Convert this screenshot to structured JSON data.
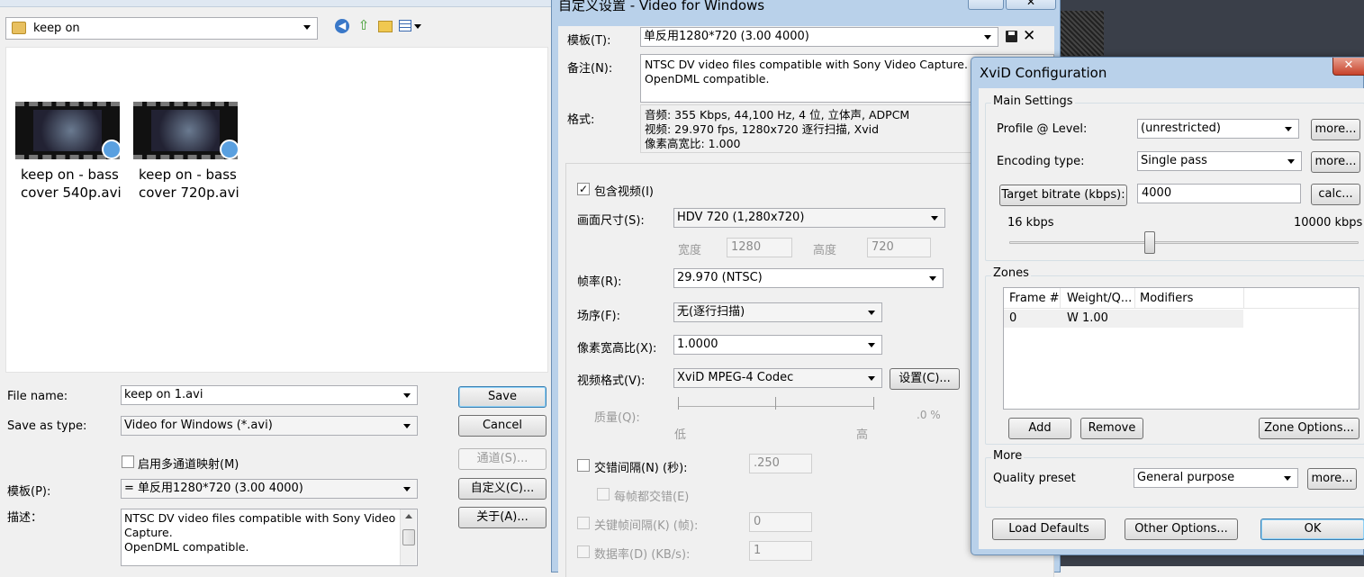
{
  "file_dialog": {
    "location": "keep on",
    "files": [
      {
        "name_line1": "keep on - bass",
        "name_line2": "cover 540p.avi"
      },
      {
        "name_line1": "keep on - bass",
        "name_line2": "cover 720p.avi"
      }
    ],
    "file_name_label": "File name:",
    "file_name_value": "keep on 1.avi",
    "save_as_type_label": "Save as type:",
    "save_as_type_value": "Video for Windows (*.avi)",
    "save_label": "Save",
    "cancel_label": "Cancel",
    "multichannel_label": "启用多通道映射(M)",
    "channels_label": "通道(S)...",
    "template_label": "模板(P):",
    "template_value": "= 单反用1280*720 (3.00 4000)",
    "customize_label": "自定义(C)...",
    "description_label": "描述：",
    "description_text": "NTSC DV video files compatible with Sony Video Capture.\nOpenDML compatible.",
    "about_label": "关于(A)..."
  },
  "custom_settings": {
    "title": "自定义设置 - Video for Windows",
    "template_label": "模板(T):",
    "template_value": "单反用1280*720 (3.00 4000)",
    "notes_label": "备注(N):",
    "notes_text": "NTSC DV video files compatible with Sony Video Capture.\nOpenDML compatible.",
    "format_label": "格式:",
    "format_text": "音频: 355 Kbps, 44,100 Hz, 4 位, 立体声, ADPCM\n视频: 29.970 fps, 1280x720 逐行扫描, Xvid\n像素高宽比: 1.000",
    "include_video_label": "包含视频(I)",
    "frame_size_label": "画面尺寸(S):",
    "frame_size_value": "HDV 720 (1,280x720)",
    "width_label": "宽度",
    "width_value": "1280",
    "height_label": "高度",
    "height_value": "720",
    "frame_rate_label": "帧率(R):",
    "frame_rate_value": "29.970 (NTSC)",
    "field_order_label": "场序(F):",
    "field_order_value": "无(逐行扫描)",
    "pixel_aspect_label": "像素宽高比(X):",
    "pixel_aspect_value": "1.0000",
    "video_format_label": "视频格式(V):",
    "video_format_value": "XviD MPEG-4 Codec",
    "setup_label": "设置(C)...",
    "quality_label": "质量(Q):",
    "quality_low": "低",
    "quality_high": "高",
    "quality_value": ".0 %",
    "interleave_label": "交错间隔(N) (秒):",
    "interleave_value": ".250",
    "interleave_every_frame_label": "每帧都交错(E)",
    "keyframe_label": "关键帧间隔(K) (帧):",
    "keyframe_value": "0",
    "data_rate_label": "数据率(D) (KB/s):",
    "data_rate_value": "1"
  },
  "xvid": {
    "title": "XviD Configuration",
    "main_settings_label": "Main Settings",
    "profile_label": "Profile @ Level:",
    "profile_value": "(unrestricted)",
    "more_label": "more...",
    "encoding_type_label": "Encoding type:",
    "encoding_type_value": "Single pass",
    "target_bitrate_label": "Target bitrate (kbps):",
    "target_bitrate_value": "4000",
    "calc_label": "calc...",
    "bitrate_min": "16 kbps",
    "bitrate_max": "10000 kbps",
    "bitrate_fraction": 0.4,
    "zones_label": "Zones",
    "zones_columns": [
      "Frame #",
      "Weight/Q...",
      "Modifiers"
    ],
    "zones_rows": [
      {
        "frame": "0",
        "weight": "W 1.00",
        "modifiers": ""
      }
    ],
    "add_label": "Add",
    "remove_label": "Remove",
    "zone_options_label": "Zone Options...",
    "more_section_label": "More",
    "quality_preset_label": "Quality preset",
    "quality_preset_value": "General purpose",
    "load_defaults_label": "Load Defaults",
    "other_options_label": "Other Options...",
    "ok_label": "OK"
  },
  "colors": {
    "window_frame": "#b9d1ea",
    "accent_blue": "#3c7fb1",
    "dark_bg": "#2a2f3a"
  }
}
